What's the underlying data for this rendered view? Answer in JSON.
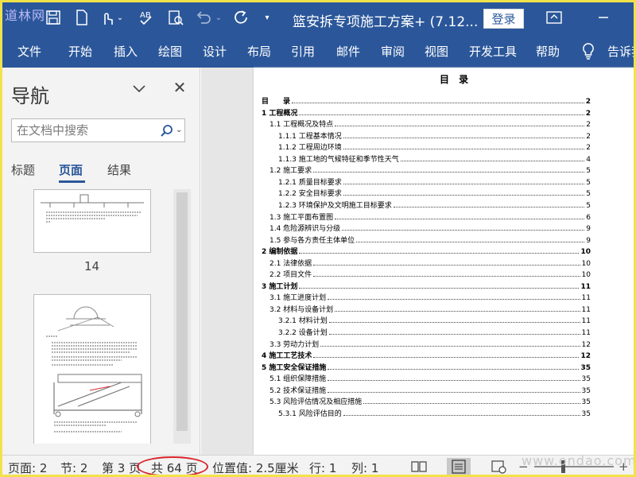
{
  "window": {
    "logo_text": "道林网",
    "title": "篮安拆专项施工方案+ (7.12...",
    "login_label": "登录"
  },
  "ribbon": {
    "tabs": [
      "文件",
      "开始",
      "插入",
      "绘图",
      "设计",
      "布局",
      "引用",
      "邮件",
      "审阅",
      "视图",
      "开发工具",
      "帮助",
      "告诉我"
    ]
  },
  "nav": {
    "title": "导航",
    "search_placeholder": "在文档中搜索",
    "tabs": [
      "标题",
      "页面",
      "结果"
    ],
    "active_tab": "页面",
    "thumbnail_page": "14"
  },
  "document": {
    "toc_title": "目 录",
    "toc": [
      {
        "level": 1,
        "text": "目　　录",
        "page": "2"
      },
      {
        "level": 1,
        "text": "1 工程概况",
        "page": "2"
      },
      {
        "level": 2,
        "text": "1.1 工程概况及特点",
        "page": "2"
      },
      {
        "level": 3,
        "text": "1.1.1 工程基本情况",
        "page": "2"
      },
      {
        "level": 3,
        "text": "1.1.2 工程周边环境",
        "page": "2"
      },
      {
        "level": 3,
        "text": "1.1.3 施工地的气候特征和季节性天气",
        "page": "4"
      },
      {
        "level": 2,
        "text": "1.2 施工要求",
        "page": "5"
      },
      {
        "level": 3,
        "text": "1.2.1 质量目标要求",
        "page": "5"
      },
      {
        "level": 3,
        "text": "1.2.2 安全目标要求",
        "page": "5"
      },
      {
        "level": 3,
        "text": "1.2.3 环境保护及文明施工目标要求",
        "page": "5"
      },
      {
        "level": 2,
        "text": "1.3 施工平面布置图",
        "page": "6"
      },
      {
        "level": 2,
        "text": "1.4 危险源辨识与分级",
        "page": "9"
      },
      {
        "level": 2,
        "text": "1.5 参与各方责任主体单位",
        "page": "9"
      },
      {
        "level": 1,
        "text": "2 编制依据",
        "page": "10"
      },
      {
        "level": 2,
        "text": "2.1 法律依据",
        "page": "10"
      },
      {
        "level": 2,
        "text": "2.2 项目文件",
        "page": "10"
      },
      {
        "level": 1,
        "text": "3 施工计划",
        "page": "11"
      },
      {
        "level": 2,
        "text": "3.1 施工进度计划",
        "page": "11"
      },
      {
        "level": 2,
        "text": "3.2 材料与设备计划",
        "page": "11"
      },
      {
        "level": 3,
        "text": "3.2.1 材料计划",
        "page": "11"
      },
      {
        "level": 3,
        "text": "3.2.2 设备计划",
        "page": "11"
      },
      {
        "level": 2,
        "text": "3.3 劳动力计划",
        "page": "12"
      },
      {
        "level": 1,
        "text": "4 施工工艺技术",
        "page": "12"
      },
      {
        "level": 1,
        "text": "5 施工安全保证措施",
        "page": "35"
      },
      {
        "level": 2,
        "text": "5.1 组织保障措施",
        "page": "35"
      },
      {
        "level": 2,
        "text": "5.2 技术保证措施",
        "page": "35"
      },
      {
        "level": 2,
        "text": "5.3 风险评估情况及相应措施",
        "page": "35"
      },
      {
        "level": 3,
        "text": "5.3.1 风险评估目的",
        "page": "35"
      }
    ]
  },
  "status": {
    "page": "页面: 2",
    "section": "节: 2",
    "page_of": "第 3 页",
    "total": "共 64 页",
    "position": "位置值: 2.5厘米",
    "line": "行: 1",
    "column": "列: 1",
    "watermark": "www.ondao.com"
  },
  "colors": {
    "ribbon": "#2b579a",
    "highlight_border": "#f2e24a",
    "annotation": "#d9262c"
  }
}
